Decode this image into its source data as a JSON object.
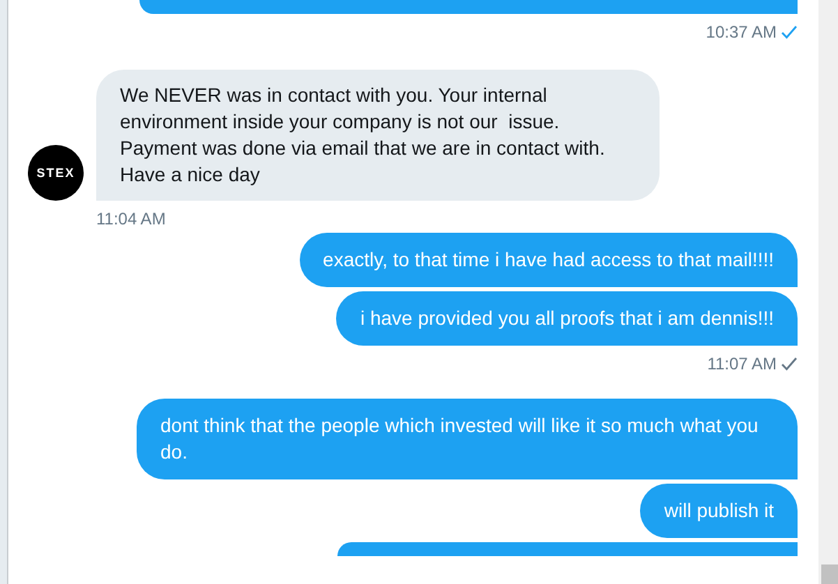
{
  "messages": [
    {
      "kind": "outgoing-cut"
    },
    {
      "kind": "time-out",
      "text": "10:37 AM",
      "read": true
    },
    {
      "kind": "incoming",
      "text": "We NEVER was in contact with you. Your internal environment inside your company is not our  issue. Payment was done via email that we are in contact with. Have a nice day",
      "avatar": "STEX"
    },
    {
      "kind": "time-in",
      "text": "11:04 AM"
    },
    {
      "kind": "outgoing",
      "text": "exactly, to that time i have had access to that mail!!!!"
    },
    {
      "kind": "outgoing",
      "text": "i have provided you all proofs that i am dennis!!!"
    },
    {
      "kind": "time-out",
      "text": "11:07 AM",
      "read": false
    },
    {
      "kind": "outgoing",
      "text": "dont think that the people which invested will like it so much what you do."
    },
    {
      "kind": "outgoing",
      "text": "will publish it"
    },
    {
      "kind": "outgoing-cut"
    }
  ]
}
